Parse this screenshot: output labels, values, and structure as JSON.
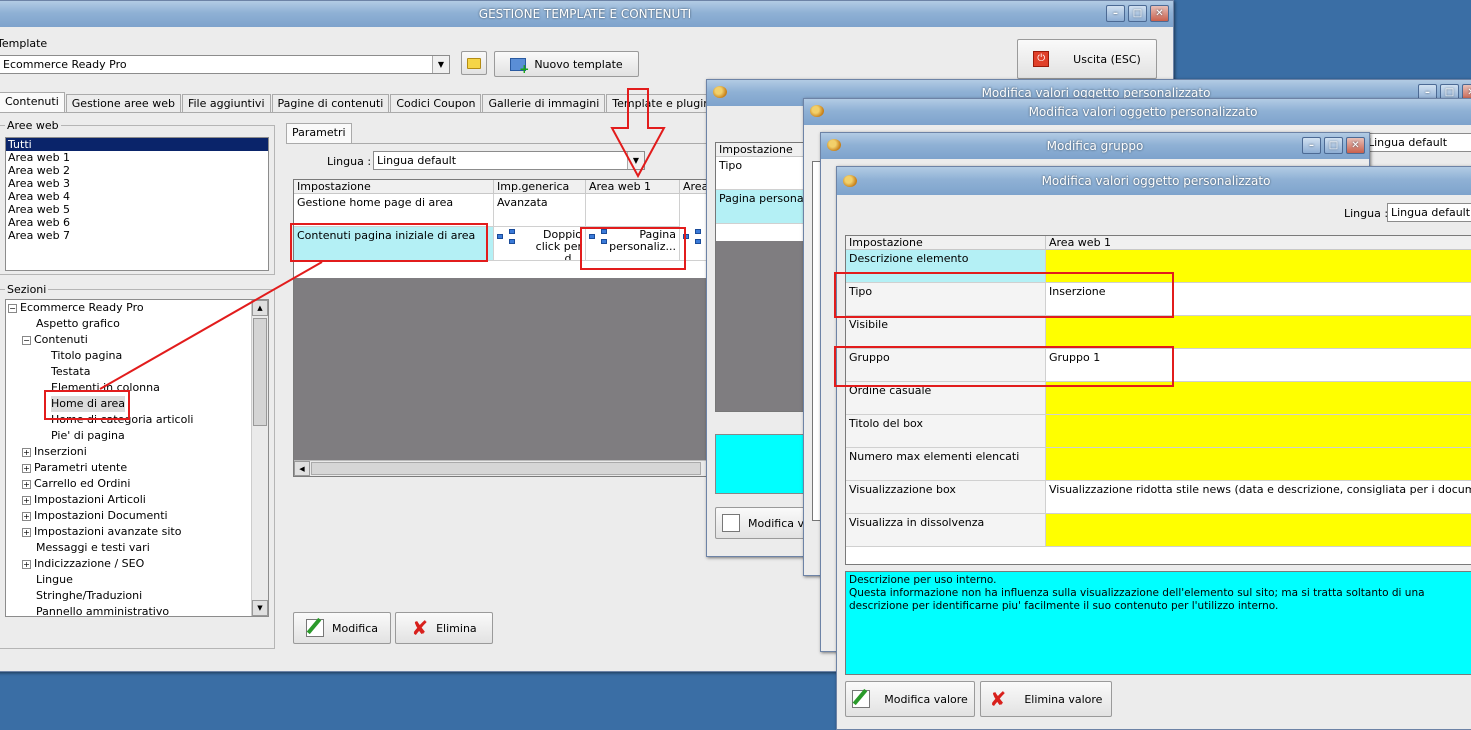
{
  "main": {
    "title": "GESTIONE TEMPLATE E CONTENUTI",
    "template_label": "Template",
    "template_value": "Ecommerce Ready Pro",
    "nuovo_template": "Nuovo template",
    "uscita": "Uscita (ESC)",
    "tabs": [
      "Contenuti",
      "Gestione aree web",
      "File aggiuntivi",
      "Pagine di contenuti",
      "Codici Coupon",
      "Gallerie di immagini",
      "Template e plugins"
    ],
    "aree_label": "Aree web",
    "aree": [
      "Tutti",
      "Area web 1",
      "Area web 2",
      "Area web 3",
      "Area web 4",
      "Area web 5",
      "Area web 6",
      "Area web 7"
    ],
    "sezioni_label": "Sezioni",
    "tree": [
      "Ecommerce Ready Pro",
      "Aspetto grafico",
      "Contenuti",
      "Titolo pagina",
      "Testata",
      "Elementi in colonna",
      "Home di area",
      "Home di categoria articoli",
      "Pie' di pagina",
      "Inserzioni",
      "Parametri utente",
      "Carrello ed Ordini",
      "Impostazioni Articoli",
      "Impostazioni Documenti",
      "Impostazioni avanzate sito",
      "Messaggi e testi vari",
      "Indicizzazione / SEO",
      "Lingue",
      "Stringhe/Traduzioni",
      "Pannello amministrativo"
    ],
    "parametri_tab": "Parametri",
    "lingua_label": "Lingua :",
    "lingua_value": "Lingua default",
    "grid_headers": [
      "Impostazione",
      "Imp.generica",
      "Area web 1",
      "Area"
    ],
    "row1": [
      "Gestione home page di area",
      "Avanzata"
    ],
    "row2_label": "Contenuti pagina iniziale di area",
    "row2_generic": "Doppio click per d...",
    "row2_area": "Pagina personaliz...",
    "modifica": "Modifica",
    "elimina": "Elimina"
  },
  "win2": {
    "title": "Modifica valori oggetto personalizzato",
    "header": "Impostazione",
    "rows": [
      "Tipo",
      "Pagina personalizzata"
    ],
    "modifica": "Modifica v"
  },
  "win3": {
    "title": "Modifica valori oggetto personalizzato",
    "lingua_value": "Lingua default"
  },
  "win4": {
    "title": "Modifica gruppo"
  },
  "win5": {
    "title": "Modifica valori oggetto personalizzato",
    "lingua_label": "Lingua :",
    "lingua_value": "Lingua default",
    "headers": [
      "Impostazione",
      "Area web 1"
    ],
    "rows": [
      {
        "label": "Descrizione elemento",
        "value": ""
      },
      {
        "label": "Tipo",
        "value": "Inserzione"
      },
      {
        "label": "Visibile",
        "value": ""
      },
      {
        "label": "Gruppo",
        "value": "Gruppo 1"
      },
      {
        "label": "Ordine casuale",
        "value": ""
      },
      {
        "label": "Titolo del box",
        "value": ""
      },
      {
        "label": "Numero max elementi elencati",
        "value": ""
      },
      {
        "label": "Visualizzazione box",
        "value": "Visualizzazione ridotta stile news (data e descrizione, consigliata per i documenti)"
      },
      {
        "label": "Visualizza in dissolvenza",
        "value": ""
      }
    ],
    "desc_title": "Descrizione per uso interno.",
    "desc_body": "Questa informazione non ha influenza sulla visualizzazione dell'elemento sul sito; ma si tratta soltanto di una descrizione per identificarne piu' facilmente il suo contenuto per l'utilizzo interno.",
    "modifica_valore": "Modifica valore",
    "elimina_valore": "Elimina valore"
  },
  "colors": {
    "cyan": "#b4f0f5",
    "yellow": "#ffff00",
    "desktop": "#3a6ea5",
    "annotation": "#e21c1c"
  }
}
